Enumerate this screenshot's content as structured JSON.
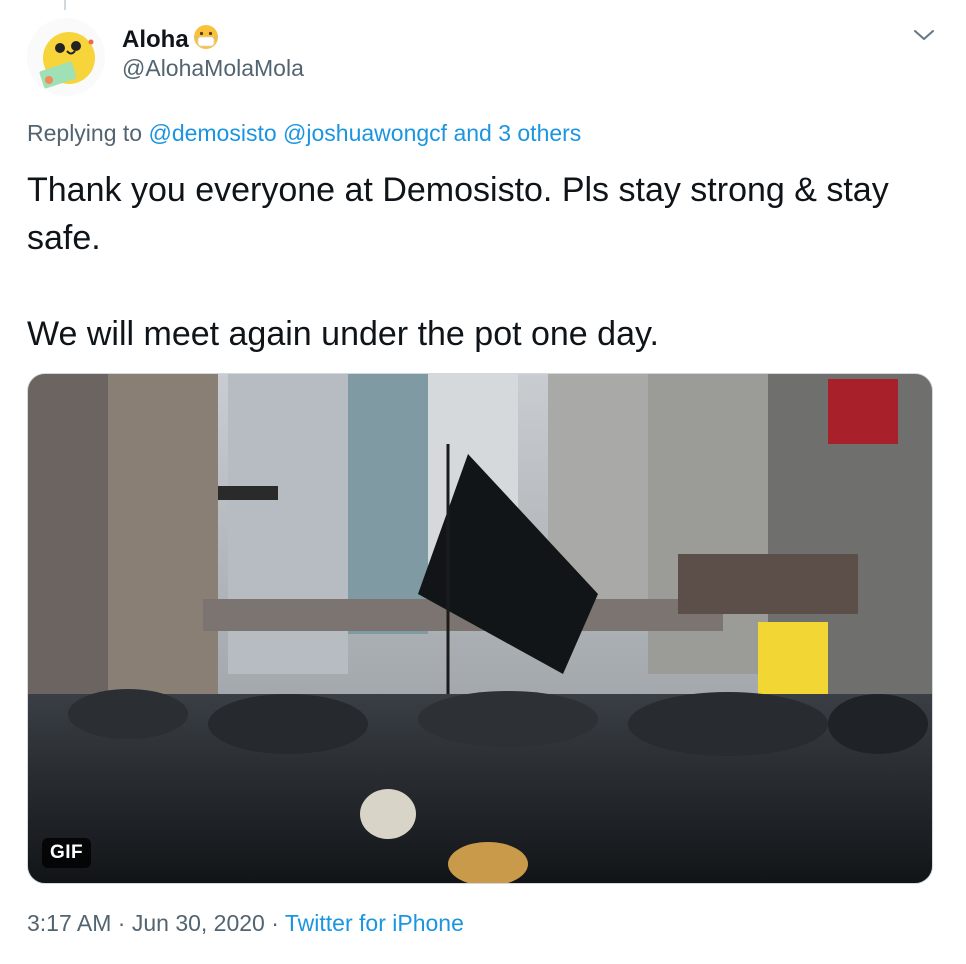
{
  "author": {
    "display_name": "Aloha",
    "name_emoji": "face-with-medical-mask-icon",
    "handle": "@AlohaMolaMola"
  },
  "reply": {
    "prefix": "Replying to",
    "mention_1": "@demosisto",
    "mention_2": "@joshuawongcf",
    "and_label": "and",
    "others": "3 others"
  },
  "tweet": {
    "paragraph_1": "Thank you everyone at Demosisto. Pls stay strong & stay safe.",
    "paragraph_2": "We will meet again under the pot one day."
  },
  "media": {
    "badge": "GIF",
    "type": "animated-gif"
  },
  "meta": {
    "time": "3:17 AM",
    "separator": "·",
    "date": "Jun 30, 2020",
    "source": "Twitter for iPhone"
  },
  "colors": {
    "link": "#1b95e0",
    "text": "#0f1419",
    "muted": "#536471"
  }
}
